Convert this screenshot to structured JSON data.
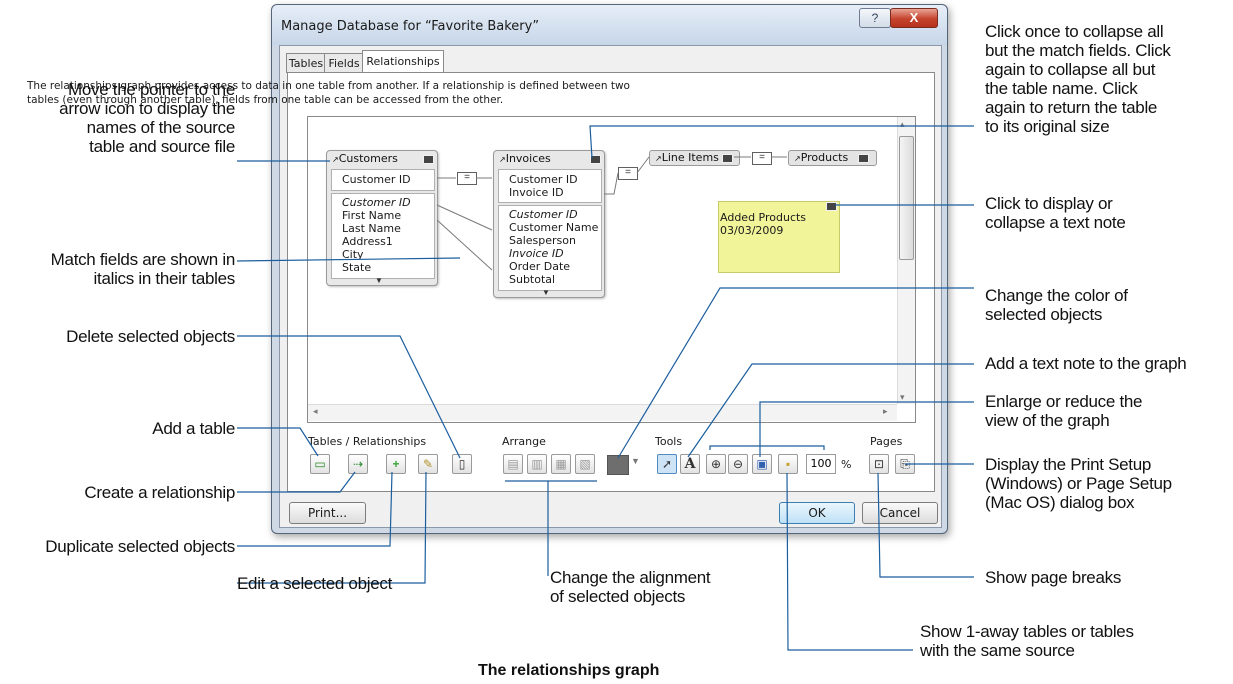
{
  "dialog": {
    "title": "Manage Database for “Favorite Bakery”",
    "help_label": "?",
    "close_label": "X",
    "tabs": [
      {
        "label": "Tables"
      },
      {
        "label": "Fields"
      },
      {
        "label": "Relationships"
      }
    ],
    "description": "The relationships graph provides access to data in one table from another. If a relationship is defined between two tables (even through another table), fields from one table can be accessed from the other."
  },
  "graph": {
    "customers": {
      "name": "Customers",
      "match_field": "Customer ID",
      "fields": [
        "Customer ID",
        "First Name",
        "Last Name",
        "Address1",
        "City",
        "State"
      ]
    },
    "invoices": {
      "name": "Invoices",
      "match_fields": [
        "Customer ID",
        "Invoice ID"
      ],
      "fields": [
        "Customer ID",
        "Customer Name",
        "Salesperson",
        "Invoice ID",
        "Order Date",
        "Subtotal"
      ]
    },
    "line_items": {
      "name": "Line Items"
    },
    "products": {
      "name": "Products"
    },
    "rel_symbol": "=",
    "note": {
      "line1": "Added Products",
      "line2": "03/03/2009"
    }
  },
  "toolbar": {
    "tables_relationships_label": "Tables / Relationships",
    "arrange_label": "Arrange",
    "tools_label": "Tools",
    "pages_label": "Pages",
    "zoom_value": "100",
    "zoom_unit": "%",
    "text_tool": "A"
  },
  "buttons": {
    "print": "Print...",
    "ok": "OK",
    "cancel": "Cancel"
  },
  "callouts": {
    "arrow_icon": [
      "Move the pointer to the",
      "arrow icon to display the",
      "names of the source",
      "table and source file"
    ],
    "match_fields": [
      "Match fields are shown in",
      "italics in their tables"
    ],
    "delete": "Delete selected objects",
    "add_table": "Add a table",
    "create_rel": "Create a relationship",
    "duplicate": "Duplicate selected objects",
    "edit": "Edit a selected object",
    "alignment": [
      "Change the alignment",
      "of selected objects"
    ],
    "collapse": [
      "Click once to collapse all",
      "but the match fields. Click",
      "again to collapse all but",
      "the table name. Click",
      "again to return the table",
      "to its original size"
    ],
    "text_note": [
      "Click to display or",
      "collapse a text note"
    ],
    "color": [
      "Change the color of",
      "selected objects"
    ],
    "add_note": "Add a text note to the graph",
    "enlarge": [
      "Enlarge or reduce the",
      "view of the graph"
    ],
    "print_setup": [
      "Display the Print Setup",
      "(Windows) or Page Setup",
      "(Mac OS) dialog box"
    ],
    "page_breaks": "Show page breaks",
    "one_away": [
      "Show 1-away tables or tables",
      "with the same source"
    ]
  },
  "caption": "The relationships graph"
}
